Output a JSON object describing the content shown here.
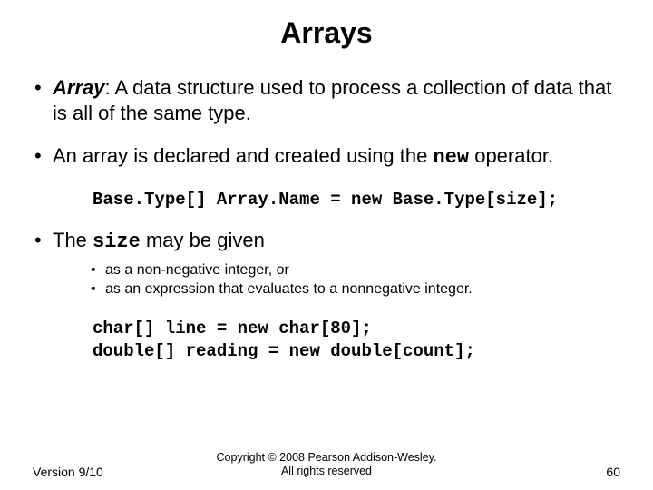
{
  "title": "Arrays",
  "bullets": {
    "b1_term": "Array",
    "b1_rest": ":  A data structure used to process a collection of data that is all of the same type.",
    "b2_a": "An array is declared and created using the ",
    "b2_kw": "new",
    "b2_b": " operator.",
    "b3_a": "The ",
    "b3_kw": "size",
    "b3_b": " may be given"
  },
  "code1": "Base.Type[] Array.Name = new Base.Type[size];",
  "sub": {
    "s1": "as a non-negative integer, or",
    "s2": "as an expression that evaluates to a nonnegative integer."
  },
  "code2_l1": "char[] line = new char[80];",
  "code2_l2": "double[] reading = new double[count];",
  "footer": {
    "version": "Version 9/10",
    "copy_l1": "Copyright © 2008 Pearson Addison-Wesley.",
    "copy_l2": "All rights reserved",
    "page": "60"
  }
}
